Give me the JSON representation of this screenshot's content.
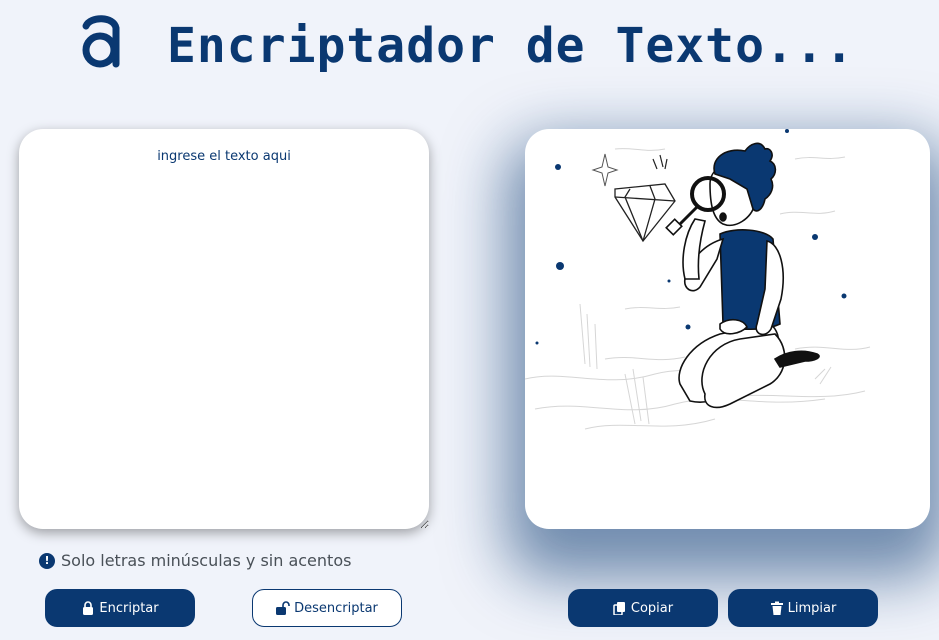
{
  "header": {
    "logo_icon": "alura-logo-icon",
    "title": "Encriptador de Texto..."
  },
  "input": {
    "placeholder": "ingrese el texto aqui",
    "value": ""
  },
  "output": {
    "illustration": "person-with-magnifying-glass-illustration"
  },
  "notice": {
    "icon": "exclamation-icon",
    "text": "Solo letras minúsculas y sin acentos"
  },
  "buttons": {
    "encrypt_label": "Encriptar",
    "decrypt_label": "Desencriptar",
    "copy_label": "Copiar",
    "clear_label": "Limpiar"
  },
  "colors": {
    "primary": "#0a3871",
    "background": "#f0f3fa",
    "panel": "#ffffff",
    "notice_text": "#495057"
  }
}
